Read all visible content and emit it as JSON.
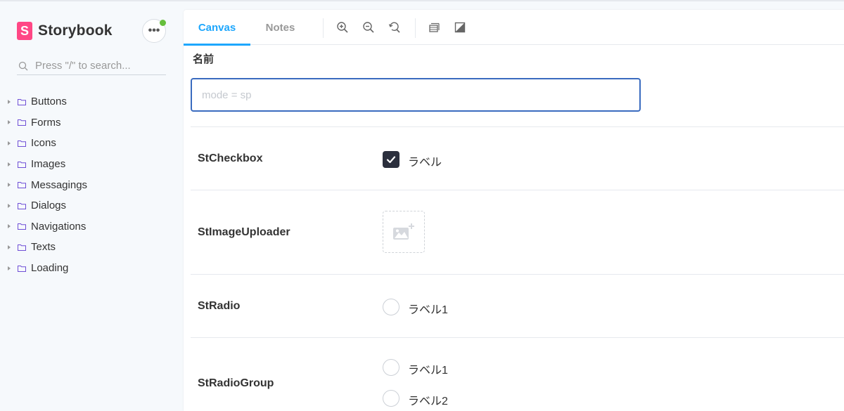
{
  "sidebar": {
    "brand": {
      "logo_letter": "S",
      "name": "Storybook",
      "logo_color": "#ff4785"
    },
    "menu_button": {
      "label": "•••",
      "status_color": "#66bf3c"
    },
    "search": {
      "placeholder": "Press \"/\" to search..."
    },
    "items": [
      {
        "label": "Buttons"
      },
      {
        "label": "Forms"
      },
      {
        "label": "Icons"
      },
      {
        "label": "Images"
      },
      {
        "label": "Messagings"
      },
      {
        "label": "Dialogs"
      },
      {
        "label": "Navigations"
      },
      {
        "label": "Texts"
      },
      {
        "label": "Loading"
      }
    ]
  },
  "toolbar": {
    "tabs": [
      {
        "label": "Canvas",
        "active": true
      },
      {
        "label": "Notes",
        "active": false
      }
    ],
    "accent": "#1ea7fd",
    "tools": [
      "zoom-in-icon",
      "zoom-out-icon",
      "zoom-reset-icon",
      "grid-icon",
      "background-icon"
    ]
  },
  "form": {
    "name_label": "名前",
    "name_input": {
      "value": "",
      "placeholder": "mode = sp"
    }
  },
  "components": {
    "checkbox": {
      "name": "StCheckbox",
      "label": "ラベル",
      "checked": true
    },
    "image_uploader": {
      "name": "StImageUploader"
    },
    "radio": {
      "name": "StRadio",
      "label": "ラベル1"
    },
    "radio_group": {
      "name": "StRadioGroup",
      "options": [
        {
          "label": "ラベル1"
        },
        {
          "label": "ラベル2"
        }
      ]
    }
  }
}
